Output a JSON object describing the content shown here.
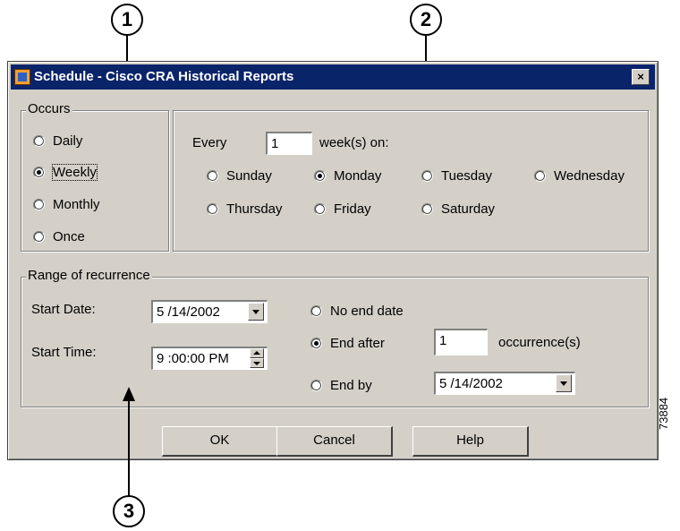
{
  "window": {
    "title": "Schedule - Cisco CRA Historical Reports",
    "close_label": "×"
  },
  "callouts": [
    "1",
    "2",
    "3"
  ],
  "occurs": {
    "group_label": "Occurs",
    "options": [
      {
        "label": "Daily",
        "checked": false
      },
      {
        "label": "Weekly",
        "checked": true
      },
      {
        "label": "Monthly",
        "checked": false
      },
      {
        "label": "Once",
        "checked": false
      }
    ]
  },
  "weekly": {
    "every_label": "Every",
    "every_value": "1",
    "unit_label": "week(s) on:",
    "days": [
      {
        "label": "Sunday",
        "checked": false
      },
      {
        "label": "Monday",
        "checked": true
      },
      {
        "label": "Tuesday",
        "checked": false
      },
      {
        "label": "Wednesday",
        "checked": false
      },
      {
        "label": "Thursday",
        "checked": false
      },
      {
        "label": "Friday",
        "checked": false
      },
      {
        "label": "Saturday",
        "checked": false
      }
    ]
  },
  "range": {
    "group_label": "Range of recurrence",
    "start_date_label": "Start Date:",
    "start_date_value": "5 /14/2002",
    "start_time_label": "Start Time:",
    "start_time_value": "9 :00:00 PM",
    "no_end_label": "No end date",
    "end_after_label": "End after",
    "end_after_value": "1",
    "occurrences_label": "occurrence(s)",
    "end_by_label": "End by",
    "end_by_value": "5 /14/2002",
    "selected": "End after"
  },
  "buttons": {
    "ok": "OK",
    "cancel": "Cancel",
    "help": "Help"
  },
  "figure_id": "73884"
}
